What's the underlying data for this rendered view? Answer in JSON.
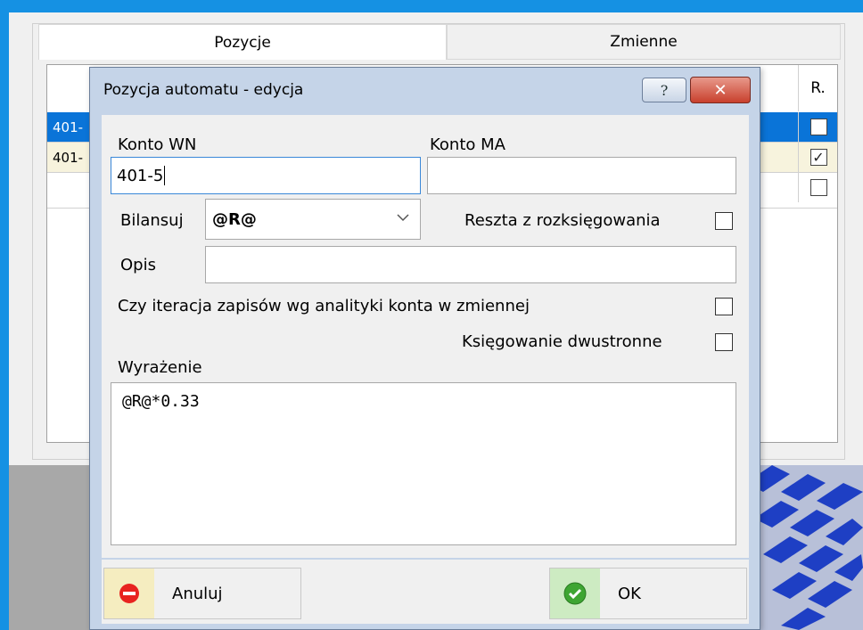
{
  "tabs": [
    {
      "label": "Pozycje",
      "active": true
    },
    {
      "label": "Zmienne",
      "active": false
    }
  ],
  "grid": {
    "header_r": "R.",
    "rows": [
      {
        "text": "401-",
        "checked": false,
        "selected": true
      },
      {
        "text": "401-",
        "checked": true,
        "selected": false
      },
      {
        "text": "",
        "checked": false,
        "selected": false
      }
    ]
  },
  "dialog": {
    "title": "Pozycja automatu - edycja",
    "help_symbol": "?",
    "close_symbol": "✕",
    "konto_wn": {
      "label": "Konto WN",
      "value": "401-5"
    },
    "konto_ma": {
      "label": "Konto MA",
      "value": ""
    },
    "bilansuj": {
      "label": "Bilansuj",
      "value": "@R@"
    },
    "reszta": {
      "label": "Reszta z rozksięgowania",
      "checked": false
    },
    "opis": {
      "label": "Opis",
      "value": ""
    },
    "iteracja": {
      "label": "Czy iteracja zapisów wg analityki konta w zmiennej",
      "checked": false
    },
    "dwustronne": {
      "label": "Księgowanie dwustronne",
      "checked": false
    },
    "wyrazenie": {
      "label": "Wyrażenie",
      "value": "@R@*0.33"
    },
    "buttons": {
      "cancel": "Anuluj",
      "ok": "OK"
    }
  },
  "colors": {
    "window_accent": "#1591e3",
    "selected_row": "#0a74d8",
    "highlight_row": "#f7f3dd",
    "dialog_frame": "#c5d4e8"
  }
}
